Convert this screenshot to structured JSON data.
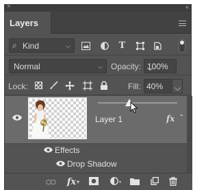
{
  "panel": {
    "tab_label": "Layers",
    "collapse_glyph": "«",
    "close_glyph": "×"
  },
  "filter": {
    "kind_label": "Kind",
    "icons": [
      "image-filter-icon",
      "adjustment-filter-icon",
      "type-filter-icon",
      "shape-filter-icon",
      "smart-object-filter-icon"
    ],
    "filter_on": true
  },
  "blend": {
    "mode": "Normal",
    "opacity_label": "Opacity:",
    "opacity_value": "100%"
  },
  "lock": {
    "label": "Lock:",
    "fill_label": "Fill:",
    "fill_value": "40%",
    "fill_slider_percent": 40
  },
  "layers": [
    {
      "name": "Layer 1",
      "visible": true,
      "fx": "fx",
      "effects_label": "Effects",
      "effects": [
        {
          "name": "Drop Shadow",
          "visible": true
        }
      ]
    }
  ],
  "footer": {
    "icons": [
      "link-layers-icon",
      "add-style-icon",
      "add-mask-icon",
      "adjustment-layer-icon",
      "new-group-icon",
      "new-layer-icon",
      "delete-layer-icon"
    ],
    "fx_text": "fx"
  },
  "colors": {
    "panel_bg": "#535353",
    "selected_layer_bg": "#6b6b6b",
    "field_bg": "#444444"
  }
}
